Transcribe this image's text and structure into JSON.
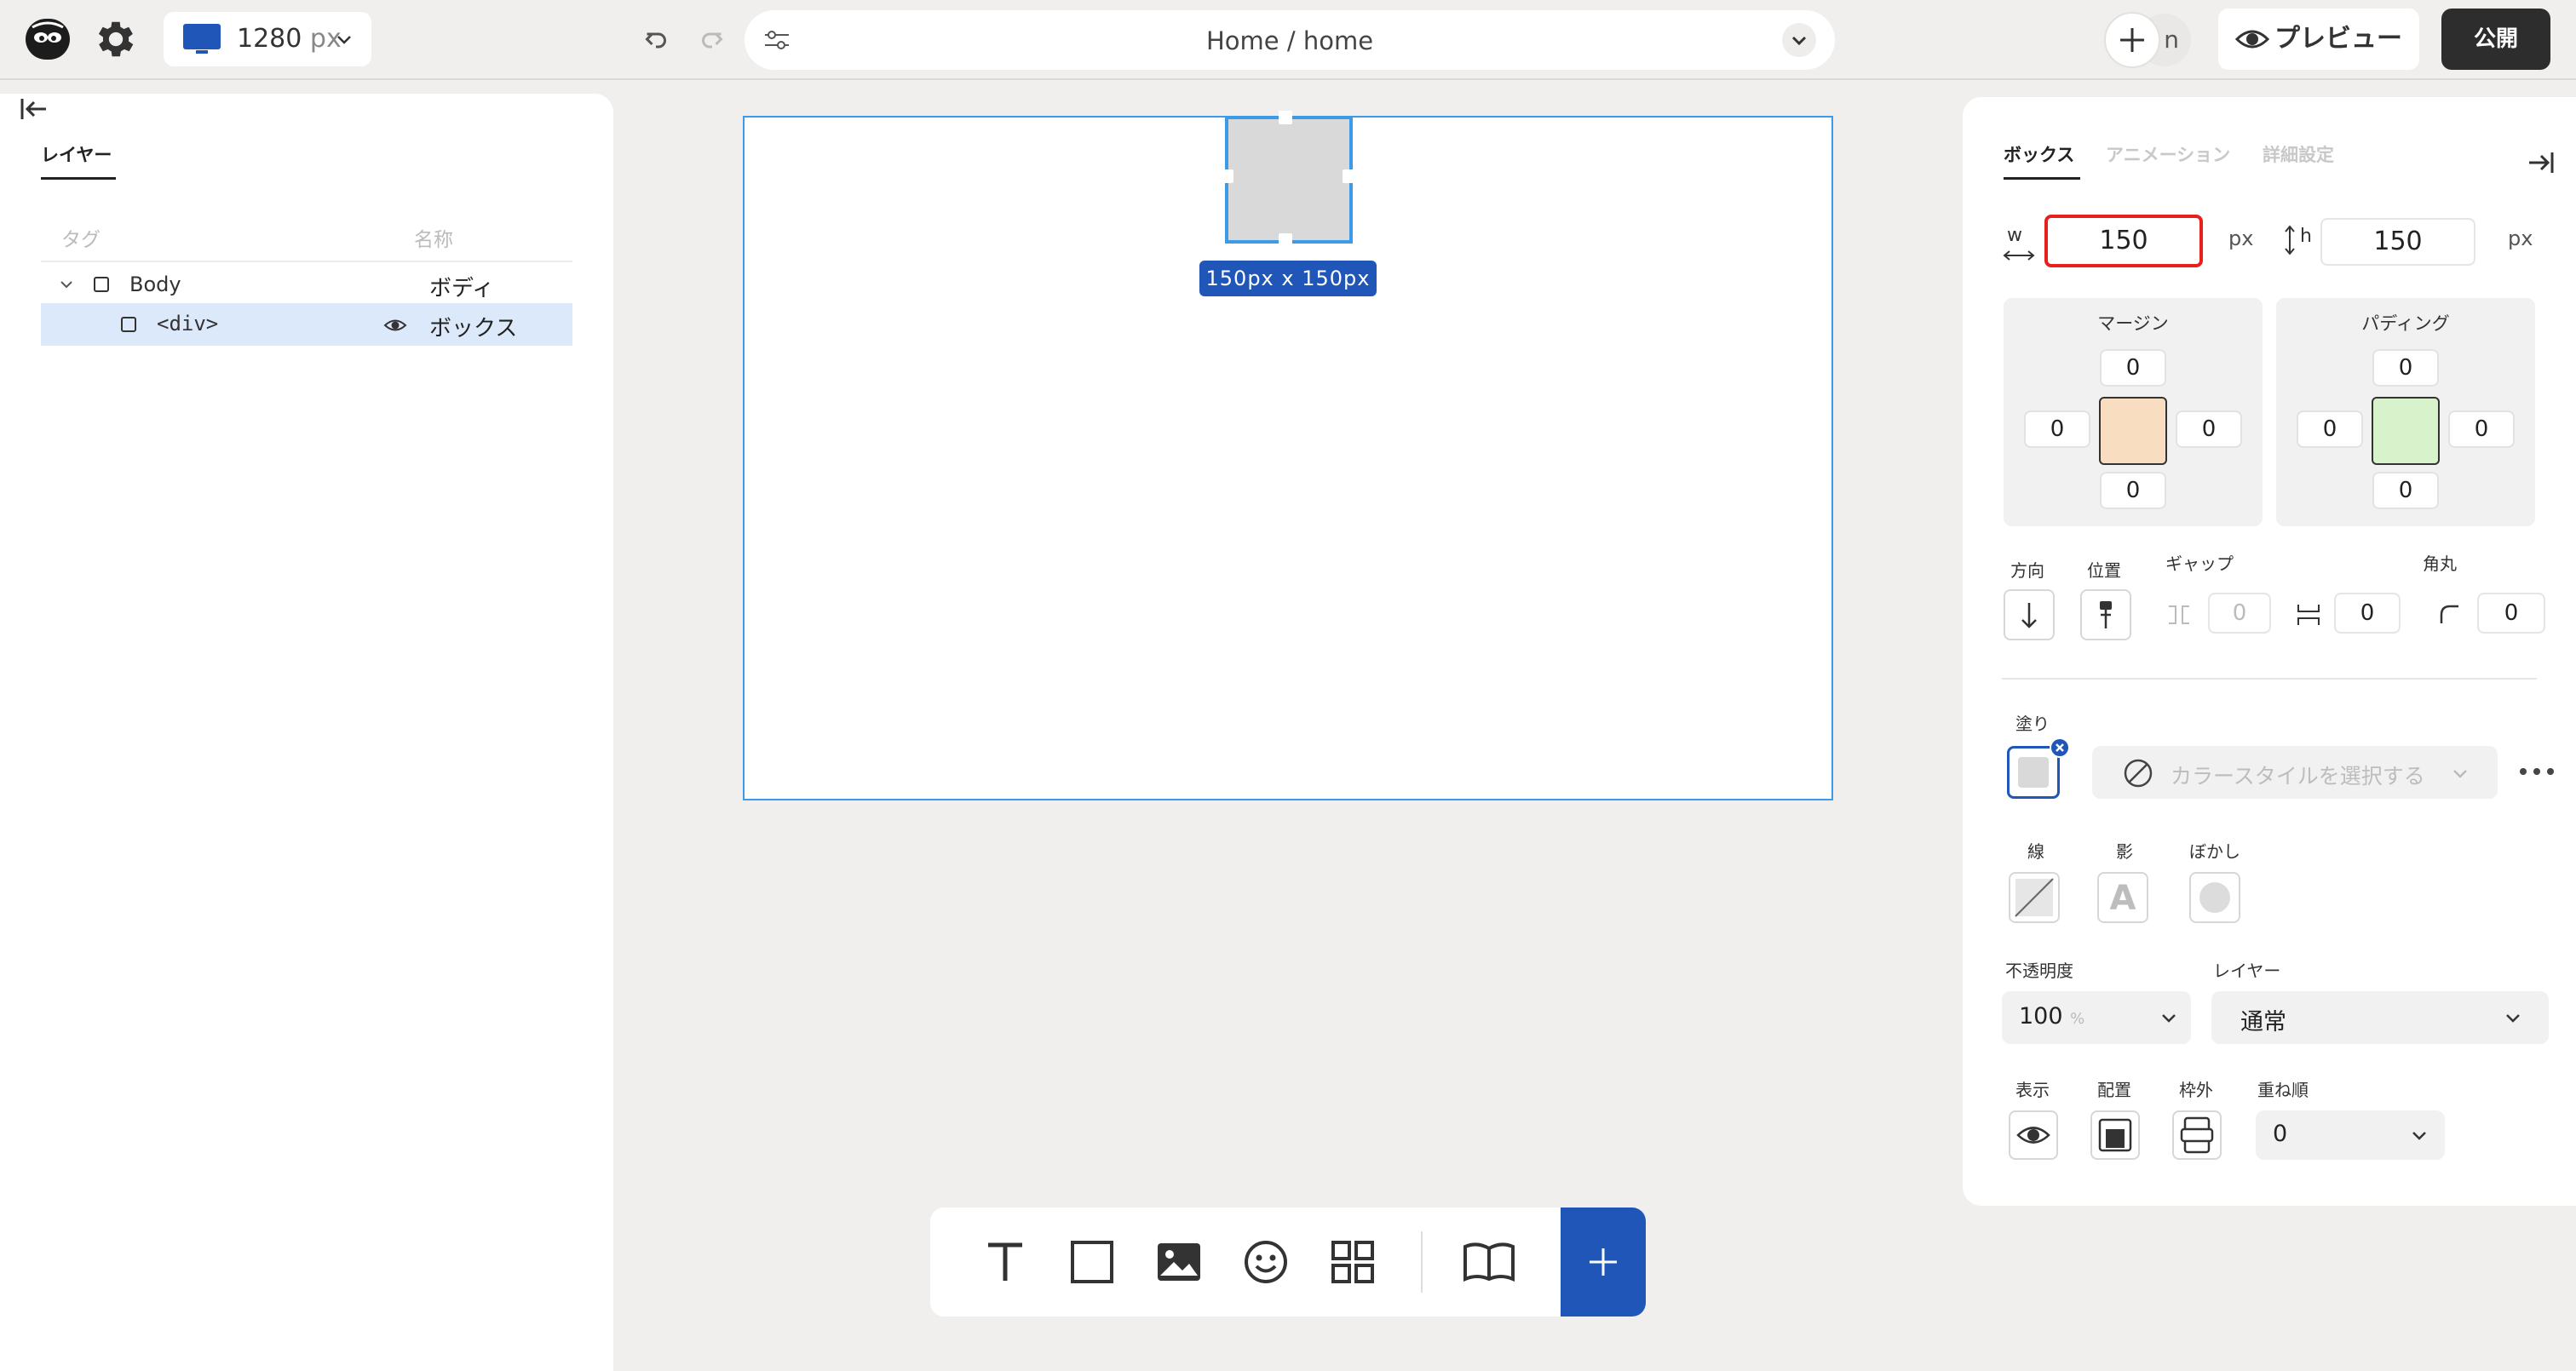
{
  "topbar": {
    "viewport_value": "1280",
    "viewport_unit": "px",
    "page_path": "Home  / home",
    "avatar_initial": "n",
    "preview_label": "プレビュー",
    "publish_label": "公開"
  },
  "left_panel": {
    "tab_label": "レイヤー",
    "col_tag": "タグ",
    "col_name": "名称",
    "rows": [
      {
        "tag": "Body",
        "name": "ボディ"
      },
      {
        "tag": "<div>",
        "name": "ボックス"
      }
    ]
  },
  "canvas": {
    "size_label": "150px x 150px"
  },
  "right_panel": {
    "tabs": [
      "ボックス",
      "アニメーション",
      "詳細設定"
    ],
    "w_label": "w",
    "width_value": "150",
    "width_unit": "px",
    "h_label": "h",
    "height_value": "150",
    "height_unit": "px",
    "margin": {
      "title": "マージン",
      "top": "0",
      "left": "0",
      "right": "0",
      "bottom": "0",
      "center_color": "#f8ddc0"
    },
    "padding": {
      "title": "パディング",
      "top": "0",
      "left": "0",
      "right": "0",
      "bottom": "0",
      "center_color": "#d8f2cc"
    },
    "direction_label": "方向",
    "position_label": "位置",
    "gap_label": "ギャップ",
    "gap_value_1": "0",
    "gap_value_2": "0",
    "radius_label": "角丸",
    "radius_value": "0",
    "fill_label": "塗り",
    "color_style_placeholder": "カラースタイルを選択する",
    "stroke_label": "線",
    "shadow_label": "影",
    "blur_label": "ぼかし",
    "opacity_label": "不透明度",
    "opacity_value": "100",
    "opacity_unit": "%",
    "layer_label": "レイヤー",
    "layer_value": "通常",
    "display_label": "表示",
    "placement_label": "配置",
    "overflow_label": "枠外",
    "zorder_label": "重ね順",
    "zorder_value": "0"
  },
  "colors": {
    "accent_blue": "#1f56b8",
    "selection_blue": "#3b9be8",
    "highlight_red": "#e8201c"
  }
}
